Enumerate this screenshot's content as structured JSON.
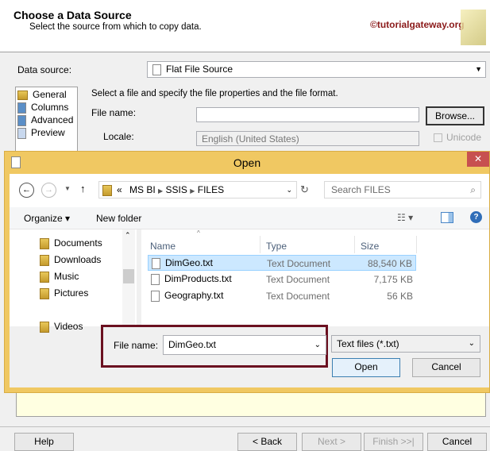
{
  "wizard": {
    "title": "Choose a Data Source",
    "subtitle": "Select the source from which to copy data.",
    "watermark": "©tutorialgateway.org",
    "data_source_label": "Data source:",
    "data_source_value": "Flat File Source",
    "pages": [
      "General",
      "Columns",
      "Advanced",
      "Preview"
    ],
    "instruction": "Select a file and specify the file properties and the file format.",
    "file_name_label": "File name:",
    "file_name_value": "",
    "browse": "Browse...",
    "locale_label": "Locale:",
    "locale_value": "English (United States)",
    "unicode": "Unicode",
    "buttons": {
      "help": "Help",
      "back": "< Back",
      "next": "Next >",
      "finish": "Finish >>|",
      "cancel": "Cancel"
    }
  },
  "open_dialog": {
    "title": "Open",
    "breadcrumb": [
      "MS BI",
      "SSIS",
      "FILES"
    ],
    "breadcrumb_prefix": "«",
    "search_placeholder": "Search FILES",
    "organize": "Organize ▾",
    "new_folder": "New folder",
    "nav": [
      "Documents",
      "Downloads",
      "Music",
      "Pictures",
      "Videos"
    ],
    "columns": [
      "Name",
      "Type",
      "Size"
    ],
    "files": [
      {
        "name": "DimGeo.txt",
        "type": "Text Document",
        "size": "88,540 KB"
      },
      {
        "name": "DimProducts.txt",
        "type": "Text Document",
        "size": "7,175 KB"
      },
      {
        "name": "Geography.txt",
        "type": "Text Document",
        "size": "56 KB"
      }
    ],
    "file_name_label": "File name:",
    "file_name_value": "DimGeo.txt",
    "file_type": "Text files (*.txt)",
    "open": "Open",
    "cancel": "Cancel"
  }
}
